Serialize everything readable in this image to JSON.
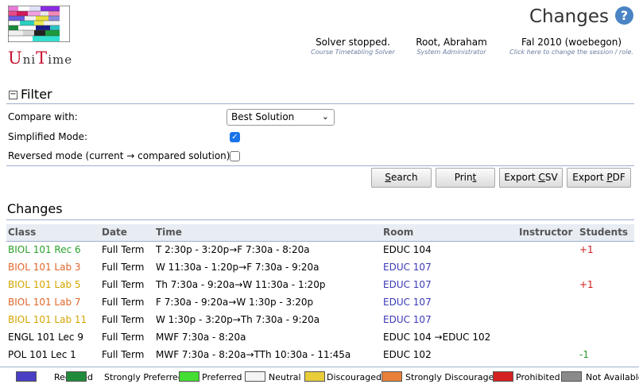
{
  "header": {
    "title": "Changes",
    "help_icon": "?",
    "logo": {
      "p1": "U",
      "p2": "ni",
      "p3": "T",
      "p4": "ime"
    },
    "solver": {
      "status": "Solver stopped.",
      "sub": "Course Timetabling Solver"
    },
    "user": {
      "name": "Root, Abraham",
      "role": "System Administrator"
    },
    "session": {
      "name": "Fal 2010 (woebegon)",
      "hint": "Click here to change the session / role."
    }
  },
  "filter": {
    "title": "Filter",
    "compare_label": "Compare with:",
    "compare_value": "Best Solution",
    "simplified_label": "Simplified Mode:",
    "simplified_checked": true,
    "reversed_label": "Reversed mode (current → compared solution):",
    "reversed_checked": false
  },
  "buttons": {
    "search": {
      "pre": "",
      "key": "S",
      "post": "earch"
    },
    "print": {
      "pre": "Prin",
      "key": "t",
      "post": ""
    },
    "csv": {
      "pre": "Export ",
      "key": "C",
      "post": "SV"
    },
    "pdf": {
      "pre": "Export ",
      "key": "P",
      "post": "DF"
    }
  },
  "changes": {
    "title": "Changes",
    "columns": [
      "Class",
      "Date",
      "Time",
      "Room",
      "Instructor",
      "Students"
    ],
    "rows": [
      {
        "class": "BIOL 101 Rec 6",
        "class_pref": "green",
        "date": "Full Term",
        "time": "T 2:30p - 3:20p→F 7:30a - 8:20a",
        "room": "EDUC 104",
        "room_pref": "black",
        "instructor": "",
        "students": "+1"
      },
      {
        "class": "BIOL 101 Lab 3",
        "class_pref": "orange",
        "date": "Full Term",
        "time": "W 11:30a - 1:20p→F 7:30a - 9:20a",
        "room": "EDUC 107",
        "room_pref": "blue",
        "instructor": "",
        "students": ""
      },
      {
        "class": "BIOL 101 Lab 5",
        "class_pref": "yellow",
        "date": "Full Term",
        "time": "Th 7:30a - 9:20a→W 11:30a - 1:20p",
        "room": "EDUC 107",
        "room_pref": "blue",
        "instructor": "",
        "students": "+1"
      },
      {
        "class": "BIOL 101 Lab 7",
        "class_pref": "orange",
        "date": "Full Term",
        "time": "F 7:30a - 9:20a→W 1:30p - 3:20p",
        "room": "EDUC 107",
        "room_pref": "blue",
        "instructor": "",
        "students": ""
      },
      {
        "class": "BIOL 101 Lab 11",
        "class_pref": "yellow",
        "date": "Full Term",
        "time": "W 1:30p - 3:20p→Th 7:30a - 9:20a",
        "room": "EDUC 107",
        "room_pref": "blue",
        "instructor": "",
        "students": ""
      },
      {
        "class": "ENGL 101 Lec 9",
        "class_pref": "black",
        "date": "Full Term",
        "time": "MWF 7:30a - 8:20a",
        "room": "EDUC 104 →EDUC 102",
        "room_pref": "black",
        "instructor": "",
        "students": ""
      },
      {
        "class": "POL 101 Lec 1",
        "class_pref": "black",
        "date": "Full Term",
        "time": "MWF 7:30a - 8:20a→TTh 10:30a - 11:45a",
        "room": "EDUC 102",
        "room_pref": "black",
        "instructor": "",
        "students": "-1"
      }
    ]
  },
  "legend": [
    {
      "label": "Required",
      "color": "#4a3fc4"
    },
    {
      "label": "Strongly Preferred",
      "color": "#1f8a3a"
    },
    {
      "label": "Preferred",
      "color": "#44dd33"
    },
    {
      "label": "Neutral",
      "color": "#f4f4f4"
    },
    {
      "label": "Discouraged",
      "color": "#e8cc3a"
    },
    {
      "label": "Strongly Discouraged",
      "color": "#e8803a"
    },
    {
      "label": "Prohibited",
      "color": "#d42020"
    },
    {
      "label": "Not Available",
      "color": "#8a8a8a"
    }
  ]
}
